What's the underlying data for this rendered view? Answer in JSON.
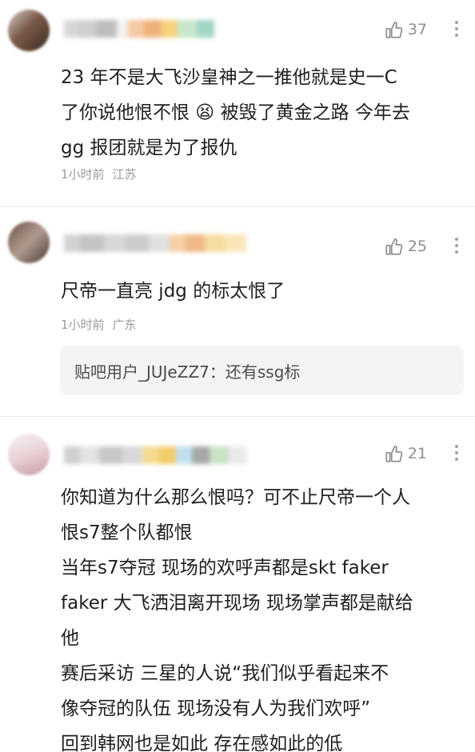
{
  "comments": [
    {
      "likes": "37",
      "text": "23 年不是大飞沙皇神之一推他就是史一C\n了你说他恨不恨 😫 被毁了黄金之路 今年去\ngg 报团就是为了报仇",
      "time": "1小时前",
      "location": "江苏"
    },
    {
      "likes": "25",
      "text": "尺帝一直亮 jdg 的标太恨了",
      "time": "1小时前",
      "location": "广东",
      "reply": "贴吧用户_JUJeZZ7：还有ssg标"
    },
    {
      "likes": "21",
      "text": "你知道为什么那么恨吗？可不止尺帝一个人\n恨s7整个队都恨\n当年s7夺冠 现场的欢呼声都是skt faker\nfaker 大飞洒泪离开现场 现场掌声都是献给\n他\n赛后采访 三星的人说“我们似乎看起来不\n像夺冠的队伍 现场没有人为我们欢呼”\n回到韩网也是如此 存在感如此的低"
    }
  ],
  "colors": {
    "muted": "#9a9a9a",
    "reply_bg": "#f4f4f4"
  }
}
